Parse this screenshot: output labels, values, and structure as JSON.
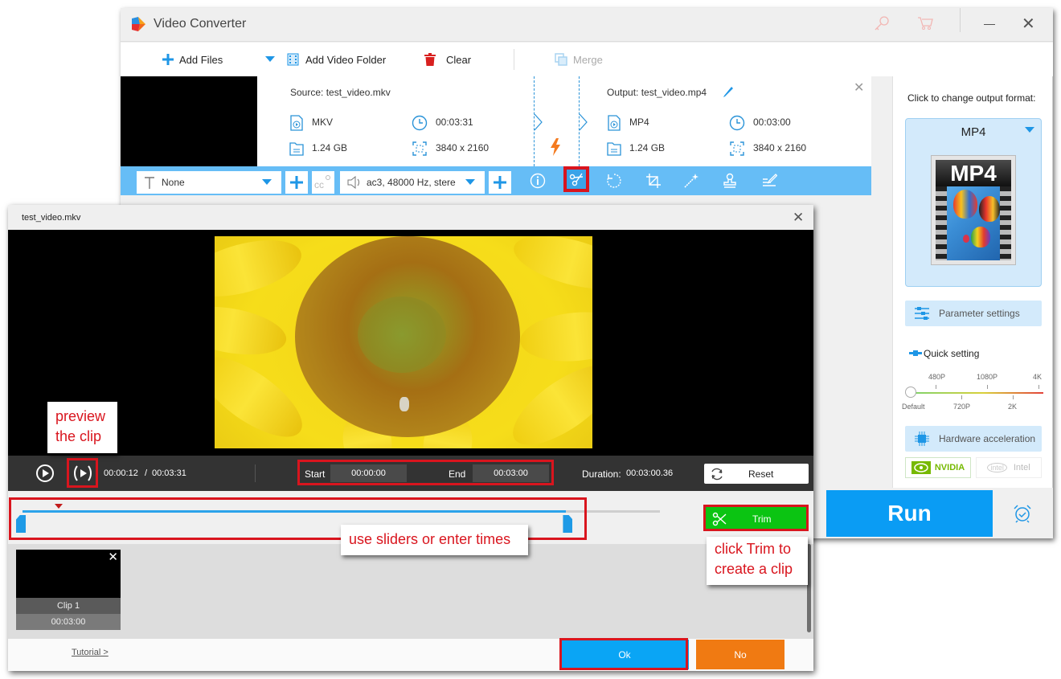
{
  "app": {
    "title": "Video Converter",
    "icons": {
      "logo": "app-logo-icon",
      "register": "key-icon",
      "store": "cart-icon",
      "minimize": "minimize-icon",
      "close": "close-icon"
    },
    "close_glyph": "✕"
  },
  "toolbar": {
    "add_files": "Add Files",
    "add_video_folder": "Add Video Folder",
    "clear": "Clear",
    "merge": "Merge"
  },
  "file_item": {
    "source_label": "Source: test_video.mkv",
    "output_label": "Output: test_video.mp4",
    "source": {
      "format": "MKV",
      "duration": "00:03:31",
      "size": "1.24 GB",
      "resolution": "3840 x 2160"
    },
    "output": {
      "format": "MP4",
      "duration": "00:03:00",
      "size": "1.24 GB",
      "resolution": "3840 x 2160"
    },
    "close_glyph": "✕"
  },
  "edit_bar": {
    "subtitle_value": "None",
    "audio_value": "ac3, 48000 Hz, stere",
    "tools": [
      "info-icon",
      "scissors-icon",
      "rotate-icon",
      "crop-icon",
      "effects-wand-icon",
      "watermark-stamp-icon",
      "edit-metadata-icon"
    ],
    "active_tool": "scissors-icon"
  },
  "right_panel": {
    "format_prompt": "Click to change output format:",
    "format_name": "MP4",
    "format_badge": "MP4",
    "parameter_settings": "Parameter settings",
    "quick_setting": "Quick setting",
    "quality_ticks_top": [
      "480P",
      "1080P",
      "4K"
    ],
    "quality_ticks_bottom": [
      "Default",
      "720P",
      "2K"
    ],
    "quality_selected": "Default",
    "hardware_acceleration": "Hardware acceleration",
    "nvidia": "NVIDIA",
    "intel": "Intel",
    "intel_logo": "intel"
  },
  "run": {
    "label": "Run",
    "schedule_icon": "alarm-clock-icon"
  },
  "dialog": {
    "title": "test_video.mkv",
    "close_glyph": "✕",
    "current_time": "00:00:12",
    "separator": "/",
    "total_time": "00:03:31",
    "start_label": "Start",
    "start_value": "00:00:00",
    "end_label": "End",
    "end_value": "00:03:00",
    "duration_label": "Duration:",
    "duration_value": "00:03:00.36",
    "reset": "Reset",
    "trim": "Trim",
    "trim_selection": {
      "start_fraction": 0.0,
      "end_fraction": 0.853
    },
    "playhead_fraction": 0.057,
    "clips": [
      {
        "name": "Clip 1",
        "duration": "00:03:00",
        "close_glyph": "✕"
      }
    ],
    "tutorial": "Tutorial >",
    "ok": "Ok",
    "no": "No"
  },
  "annotations": {
    "preview": [
      "preview",
      "the clip"
    ],
    "sliders": "use sliders or enter times",
    "trim": [
      "click Trim to",
      "create a clip"
    ],
    "highlight_color": "#d9151e"
  },
  "colors": {
    "accent_blue": "#0a9cf4",
    "edit_bar": "#66bdf6",
    "trim_green": "#0bc412",
    "no_orange": "#f07a12"
  }
}
